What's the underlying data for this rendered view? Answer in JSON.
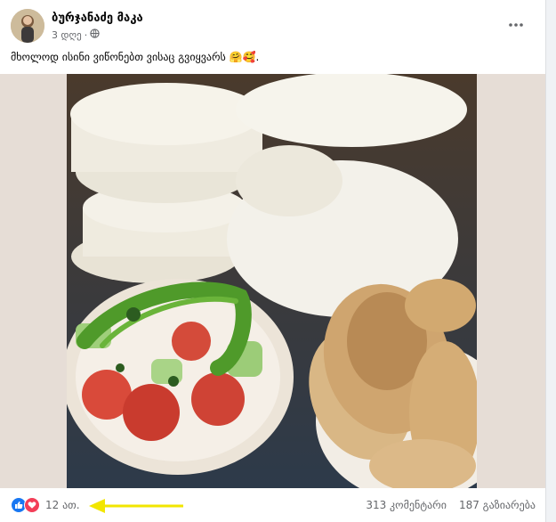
{
  "post": {
    "author": "ბურჯანაძე მაკა",
    "time": "3 დღე",
    "separator": "·",
    "text": "მხოლოდ ისინი ვიწონებთ ვისაც გვიყვარს 🤗🥰."
  },
  "icons": {
    "more": "more-horizontal-icon",
    "privacy": "globe-icon",
    "like": "like-reaction-icon",
    "love": "love-reaction-icon",
    "annotation": "yellow-arrow"
  },
  "footer": {
    "reaction_count": "12 ათ.",
    "comments": "313 კომენტარი",
    "shares": "187 გაზიარება"
  },
  "colors": {
    "like": "#1877f2",
    "love": "#f33e58",
    "annotation_arrow": "#f2e600"
  }
}
